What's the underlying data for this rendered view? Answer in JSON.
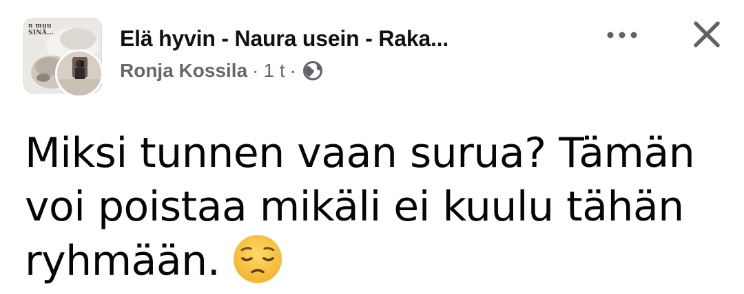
{
  "post": {
    "group_name": "Elä hyvin - Naura usein - Raka...",
    "author": "Ronja Kossila",
    "separator": "·",
    "time": "1 t",
    "privacy_icon": "globe-icon",
    "more_icon": "more-dots-icon",
    "close_icon": "close-icon",
    "group_avatar_text": "n muu\nSINÄ...",
    "body_lines": [
      "Miksi tunnen vaan surua? Tämän",
      "voi poistaa mikäli ei kuulu tähän",
      "ryhmään."
    ],
    "emoji": "pensive-face-emoji"
  },
  "colors": {
    "text": "#050505",
    "meta": "#65676b",
    "icon": "#5f6368",
    "emoji_face": "#f7c440"
  }
}
